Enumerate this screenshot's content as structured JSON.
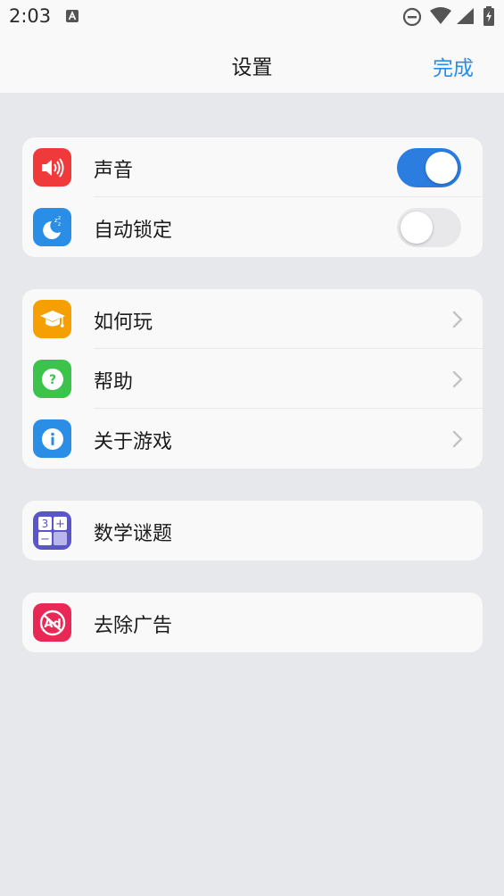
{
  "status_bar": {
    "time": "2:03"
  },
  "nav": {
    "title": "设置",
    "done_label": "完成"
  },
  "colors": {
    "accent": "#2b8ee6",
    "sound_icon_bg": "#f0393a",
    "autolock_icon_bg": "#2b8ee6",
    "howto_icon_bg": "#f5a000",
    "help_icon_bg": "#3cc34b",
    "about_icon_bg": "#2b8ee6",
    "math_icon_bg": "#5a55c8",
    "ads_icon_bg": "#ea2855"
  },
  "settings_group": {
    "items": [
      {
        "label": "声音",
        "icon": "speaker-icon",
        "toggle": true
      },
      {
        "label": "自动锁定",
        "icon": "sleep-moon-icon",
        "toggle": false
      }
    ]
  },
  "info_group": {
    "items": [
      {
        "label": "如何玩",
        "icon": "graduation-cap-icon"
      },
      {
        "label": "帮助",
        "icon": "question-icon"
      },
      {
        "label": "关于游戏",
        "icon": "info-icon"
      }
    ]
  },
  "math_group": {
    "label": "数学谜题",
    "icon": "calculator-icon",
    "icon_text": [
      "3",
      "+",
      "−"
    ]
  },
  "ads_group": {
    "label": "去除广告",
    "icon": "no-ads-icon",
    "icon_text": "Ad"
  }
}
